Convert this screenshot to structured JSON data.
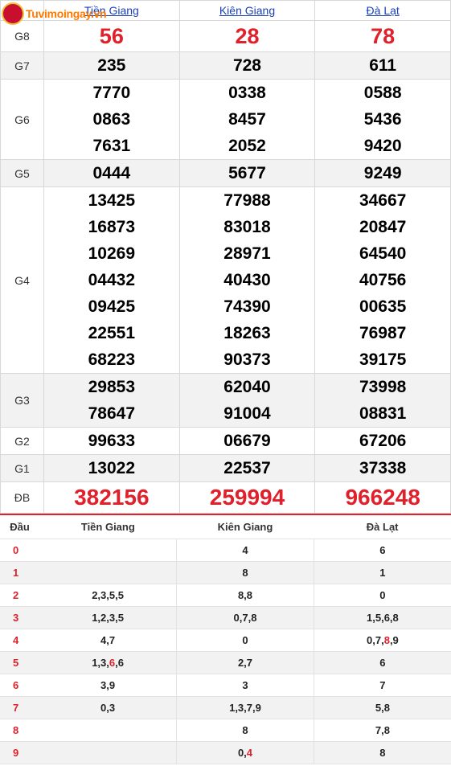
{
  "watermark": "Tuvimoingay.vn",
  "provinces": [
    "Tiền Giang",
    "Kiên Giang",
    "Đà Lạt"
  ],
  "prizes": [
    {
      "label": "G8",
      "values": [
        [
          "56"
        ],
        [
          "28"
        ],
        [
          "78"
        ]
      ]
    },
    {
      "label": "G7",
      "values": [
        [
          "235"
        ],
        [
          "728"
        ],
        [
          "611"
        ]
      ]
    },
    {
      "label": "G6",
      "values": [
        [
          "7770",
          "0863",
          "7631"
        ],
        [
          "0338",
          "8457",
          "2052"
        ],
        [
          "0588",
          "5436",
          "9420"
        ]
      ]
    },
    {
      "label": "G5",
      "values": [
        [
          "0444"
        ],
        [
          "5677"
        ],
        [
          "9249"
        ]
      ]
    },
    {
      "label": "G4",
      "values": [
        [
          "13425",
          "16873",
          "10269",
          "04432",
          "09425",
          "22551",
          "68223"
        ],
        [
          "77988",
          "83018",
          "28971",
          "40430",
          "74390",
          "18263",
          "90373"
        ],
        [
          "34667",
          "20847",
          "64540",
          "40756",
          "00635",
          "76987",
          "39175"
        ]
      ]
    },
    {
      "label": "G3",
      "values": [
        [
          "29853",
          "78647"
        ],
        [
          "62040",
          "91004"
        ],
        [
          "73998",
          "08831"
        ]
      ]
    },
    {
      "label": "G2",
      "values": [
        [
          "99633"
        ],
        [
          "06679"
        ],
        [
          "67206"
        ]
      ]
    },
    {
      "label": "G1",
      "values": [
        [
          "13022"
        ],
        [
          "22537"
        ],
        [
          "37338"
        ]
      ]
    },
    {
      "label": "ĐB",
      "values": [
        [
          "382156"
        ],
        [
          "259994"
        ],
        [
          "966248"
        ]
      ]
    }
  ],
  "loto": {
    "header": [
      "Đầu",
      "Tiền Giang",
      "Kiên Giang",
      "Đà Lạt"
    ],
    "rows": [
      {
        "head": "0",
        "cols": [
          [],
          [
            {
              "t": "4"
            }
          ],
          [
            {
              "t": "6"
            }
          ]
        ]
      },
      {
        "head": "1",
        "cols": [
          [],
          [
            {
              "t": "8"
            }
          ],
          [
            {
              "t": "1"
            }
          ]
        ]
      },
      {
        "head": "2",
        "cols": [
          [
            {
              "t": "2,3,5,5"
            }
          ],
          [
            {
              "t": "8,8"
            }
          ],
          [
            {
              "t": "0"
            }
          ]
        ]
      },
      {
        "head": "3",
        "cols": [
          [
            {
              "t": "1,2,3,5"
            }
          ],
          [
            {
              "t": "0,7,8"
            }
          ],
          [
            {
              "t": "1,5,6,8"
            }
          ]
        ]
      },
      {
        "head": "4",
        "cols": [
          [
            {
              "t": "4,7"
            }
          ],
          [
            {
              "t": "0"
            }
          ],
          [
            {
              "t": "0,7,"
            },
            {
              "t": "8",
              "red": true
            },
            {
              "t": ",9"
            }
          ]
        ]
      },
      {
        "head": "5",
        "cols": [
          [
            {
              "t": "1,3,"
            },
            {
              "t": "6",
              "red": true
            },
            {
              "t": ",6"
            }
          ],
          [
            {
              "t": "2,7"
            }
          ],
          [
            {
              "t": "6"
            }
          ]
        ]
      },
      {
        "head": "6",
        "cols": [
          [
            {
              "t": "3,9"
            }
          ],
          [
            {
              "t": "3"
            }
          ],
          [
            {
              "t": "7"
            }
          ]
        ]
      },
      {
        "head": "7",
        "cols": [
          [
            {
              "t": "0,3"
            }
          ],
          [
            {
              "t": "1,3,7,9"
            }
          ],
          [
            {
              "t": "5,8"
            }
          ]
        ]
      },
      {
        "head": "8",
        "cols": [
          [],
          [
            {
              "t": "8"
            }
          ],
          [
            {
              "t": "7,8"
            }
          ]
        ]
      },
      {
        "head": "9",
        "cols": [
          [],
          [
            {
              "t": "0,"
            },
            {
              "t": "4",
              "red": true
            }
          ],
          [
            {
              "t": "8"
            }
          ]
        ]
      }
    ]
  }
}
